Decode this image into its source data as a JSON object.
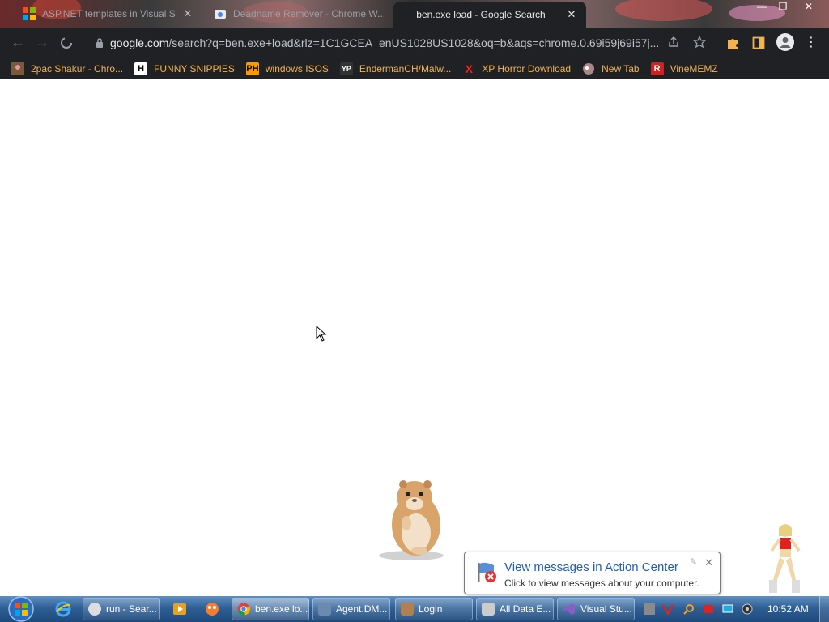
{
  "tabs": [
    {
      "title": "ASP.NET templates in Visual Stu...",
      "active": false
    },
    {
      "title": "Deadname Remover - Chrome W...",
      "active": false
    },
    {
      "title": "ben.exe load - Google Search",
      "active": true
    }
  ],
  "toolbar": {
    "url_host": "google.com",
    "url_path": "/search?q=ben.exe+load&rlz=1C1GCEA_enUS1028US1028&oq=b&aqs=chrome.0.69i59j69i57j..."
  },
  "bookmarks": [
    {
      "label": "2pac Shakur - Chro...",
      "icon": "2pac-favicon"
    },
    {
      "label": "FUNNY SNIPPIES",
      "icon": "H"
    },
    {
      "label": "windows ISOS",
      "icon": "PH"
    },
    {
      "label": "EndermanCH/Malw...",
      "icon": "YP"
    },
    {
      "label": "XP Horror Download",
      "icon": "X"
    },
    {
      "label": "New Tab",
      "icon": "globe-icon"
    },
    {
      "label": "VineMEMZ",
      "icon": "R"
    }
  ],
  "notification": {
    "title": "View messages in Action Center",
    "body": "Click to view messages about your computer."
  },
  "taskbar": {
    "tasks": [
      {
        "label": "run - Sear..."
      },
      {
        "label": "ben.exe lo..."
      },
      {
        "label": "Agent.DM..."
      },
      {
        "label": "Login"
      },
      {
        "label": "All Data E..."
      },
      {
        "label": "Visual Stu..."
      }
    ],
    "clock": "10:52 AM"
  },
  "colors": {
    "chrome_dark": "#202124",
    "bookmark_text": "#f3b24d",
    "taskbar_blue": "#2f5f95",
    "notification_title": "#1e5ebf"
  }
}
